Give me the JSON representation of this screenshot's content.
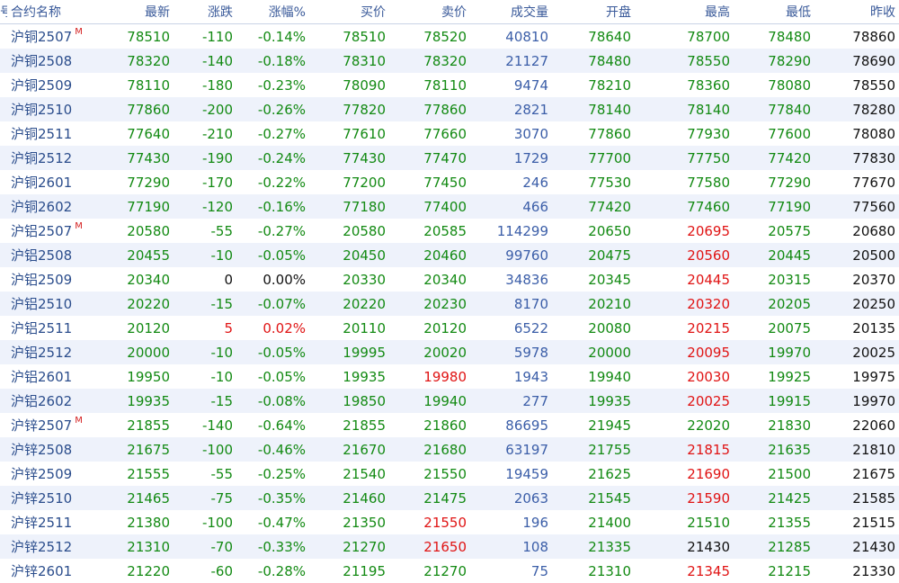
{
  "headers": [
    {
      "key": "idx",
      "label": "号"
    },
    {
      "key": "name",
      "label": "合约名称"
    },
    {
      "key": "last",
      "label": "最新"
    },
    {
      "key": "chg",
      "label": "涨跌"
    },
    {
      "key": "pct",
      "label": "涨幅%"
    },
    {
      "key": "bid",
      "label": "买价"
    },
    {
      "key": "ask",
      "label": "卖价"
    },
    {
      "key": "vol",
      "label": "成交量"
    },
    {
      "key": "open",
      "label": "开盘"
    },
    {
      "key": "high",
      "label": "最高"
    },
    {
      "key": "low",
      "label": "最低"
    },
    {
      "key": "prev",
      "label": "昨收"
    }
  ],
  "colors": {
    "up": "#e01414",
    "down": "#138a13",
    "flat": "#111111",
    "volume": "#3b5ea8",
    "name": "#2b4d8c",
    "main_mark": "#d42020"
  },
  "rows": [
    {
      "name": "沪铜2507",
      "mark": "M",
      "last": "78510",
      "chg": "-110",
      "pct": "-0.14%",
      "bid": "78510",
      "ask": "78520",
      "vol": "40810",
      "open": "78640",
      "high": "78700",
      "low": "78480",
      "prev": "78860"
    },
    {
      "name": "沪铜2508",
      "mark": "",
      "last": "78320",
      "chg": "-140",
      "pct": "-0.18%",
      "bid": "78310",
      "ask": "78320",
      "vol": "21127",
      "open": "78480",
      "high": "78550",
      "low": "78290",
      "prev": "78690"
    },
    {
      "name": "沪铜2509",
      "mark": "",
      "last": "78110",
      "chg": "-180",
      "pct": "-0.23%",
      "bid": "78090",
      "ask": "78110",
      "vol": "9474",
      "open": "78210",
      "high": "78360",
      "low": "78080",
      "prev": "78550"
    },
    {
      "name": "沪铜2510",
      "mark": "",
      "last": "77860",
      "chg": "-200",
      "pct": "-0.26%",
      "bid": "77820",
      "ask": "77860",
      "vol": "2821",
      "open": "78140",
      "high": "78140",
      "low": "77840",
      "prev": "78280"
    },
    {
      "name": "沪铜2511",
      "mark": "",
      "last": "77640",
      "chg": "-210",
      "pct": "-0.27%",
      "bid": "77610",
      "ask": "77660",
      "vol": "3070",
      "open": "77860",
      "high": "77930",
      "low": "77600",
      "prev": "78080"
    },
    {
      "name": "沪铜2512",
      "mark": "",
      "last": "77430",
      "chg": "-190",
      "pct": "-0.24%",
      "bid": "77430",
      "ask": "77470",
      "vol": "1729",
      "open": "77700",
      "high": "77750",
      "low": "77420",
      "prev": "77830"
    },
    {
      "name": "沪铜2601",
      "mark": "",
      "last": "77290",
      "chg": "-170",
      "pct": "-0.22%",
      "bid": "77200",
      "ask": "77450",
      "vol": "246",
      "open": "77530",
      "high": "77580",
      "low": "77290",
      "prev": "77670"
    },
    {
      "name": "沪铜2602",
      "mark": "",
      "last": "77190",
      "chg": "-120",
      "pct": "-0.16%",
      "bid": "77180",
      "ask": "77400",
      "vol": "466",
      "open": "77420",
      "high": "77460",
      "low": "77190",
      "prev": "77560"
    },
    {
      "name": "沪铝2507",
      "mark": "M",
      "last": "20580",
      "chg": "-55",
      "pct": "-0.27%",
      "bid": "20580",
      "ask": "20585",
      "vol": "114299",
      "open": "20650",
      "high": "20695",
      "low": "20575",
      "prev": "20680"
    },
    {
      "name": "沪铝2508",
      "mark": "",
      "last": "20455",
      "chg": "-10",
      "pct": "-0.05%",
      "bid": "20450",
      "ask": "20460",
      "vol": "99760",
      "open": "20475",
      "high": "20560",
      "low": "20445",
      "prev": "20500"
    },
    {
      "name": "沪铝2509",
      "mark": "",
      "last": "20340",
      "chg": "0",
      "pct": "0.00%",
      "bid": "20330",
      "ask": "20340",
      "vol": "34836",
      "open": "20345",
      "high": "20445",
      "low": "20315",
      "prev": "20370"
    },
    {
      "name": "沪铝2510",
      "mark": "",
      "last": "20220",
      "chg": "-15",
      "pct": "-0.07%",
      "bid": "20220",
      "ask": "20230",
      "vol": "8170",
      "open": "20210",
      "high": "20320",
      "low": "20205",
      "prev": "20250"
    },
    {
      "name": "沪铝2511",
      "mark": "",
      "last": "20120",
      "chg": "5",
      "pct": "0.02%",
      "bid": "20110",
      "ask": "20120",
      "vol": "6522",
      "open": "20080",
      "high": "20215",
      "low": "20075",
      "prev": "20135"
    },
    {
      "name": "沪铝2512",
      "mark": "",
      "last": "20000",
      "chg": "-10",
      "pct": "-0.05%",
      "bid": "19995",
      "ask": "20020",
      "vol": "5978",
      "open": "20000",
      "high": "20095",
      "low": "19970",
      "prev": "20025"
    },
    {
      "name": "沪铝2601",
      "mark": "",
      "last": "19950",
      "chg": "-10",
      "pct": "-0.05%",
      "bid": "19935",
      "ask": "19980",
      "vol": "1943",
      "open": "19940",
      "high": "20030",
      "low": "19925",
      "prev": "19975"
    },
    {
      "name": "沪铝2602",
      "mark": "",
      "last": "19935",
      "chg": "-15",
      "pct": "-0.08%",
      "bid": "19850",
      "ask": "19940",
      "vol": "277",
      "open": "19935",
      "high": "20025",
      "low": "19915",
      "prev": "19970"
    },
    {
      "name": "沪锌2507",
      "mark": "M",
      "last": "21855",
      "chg": "-140",
      "pct": "-0.64%",
      "bid": "21855",
      "ask": "21860",
      "vol": "86695",
      "open": "21945",
      "high": "22020",
      "low": "21830",
      "prev": "22060"
    },
    {
      "name": "沪锌2508",
      "mark": "",
      "last": "21675",
      "chg": "-100",
      "pct": "-0.46%",
      "bid": "21670",
      "ask": "21680",
      "vol": "63197",
      "open": "21755",
      "high": "21815",
      "low": "21635",
      "prev": "21810"
    },
    {
      "name": "沪锌2509",
      "mark": "",
      "last": "21555",
      "chg": "-55",
      "pct": "-0.25%",
      "bid": "21540",
      "ask": "21550",
      "vol": "19459",
      "open": "21625",
      "high": "21690",
      "low": "21500",
      "prev": "21675"
    },
    {
      "name": "沪锌2510",
      "mark": "",
      "last": "21465",
      "chg": "-75",
      "pct": "-0.35%",
      "bid": "21460",
      "ask": "21475",
      "vol": "2063",
      "open": "21545",
      "high": "21590",
      "low": "21425",
      "prev": "21585"
    },
    {
      "name": "沪锌2511",
      "mark": "",
      "last": "21380",
      "chg": "-100",
      "pct": "-0.47%",
      "bid": "21350",
      "ask": "21550",
      "vol": "196",
      "open": "21400",
      "high": "21510",
      "low": "21355",
      "prev": "21515"
    },
    {
      "name": "沪锌2512",
      "mark": "",
      "last": "21310",
      "chg": "-70",
      "pct": "-0.33%",
      "bid": "21270",
      "ask": "21650",
      "vol": "108",
      "open": "21335",
      "high": "21430",
      "low": "21285",
      "prev": "21430"
    },
    {
      "name": "沪锌2601",
      "mark": "",
      "last": "21220",
      "chg": "-60",
      "pct": "-0.28%",
      "bid": "21195",
      "ask": "21270",
      "vol": "75",
      "open": "21310",
      "high": "21345",
      "low": "21215",
      "prev": "21330"
    }
  ]
}
